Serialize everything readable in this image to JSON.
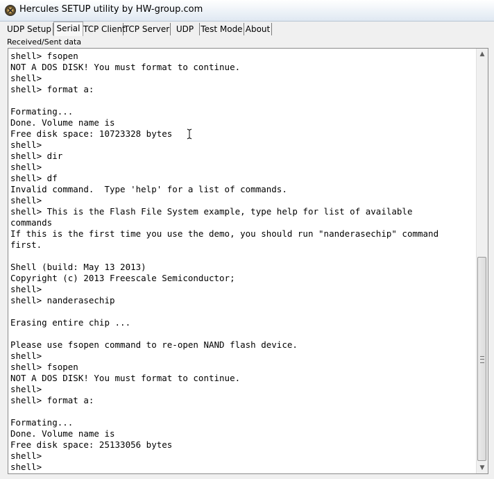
{
  "window": {
    "title": "Hercules SETUP utility by HW-group.com",
    "icon": "hercules-app-icon"
  },
  "tabs": [
    {
      "label": "UDP Setup",
      "active": false
    },
    {
      "label": "Serial",
      "active": true
    },
    {
      "label": "TCP Client",
      "active": false
    },
    {
      "label": "TCP Server",
      "active": false
    },
    {
      "label": "UDP",
      "active": false
    },
    {
      "label": "Test Mode",
      "active": false
    },
    {
      "label": "About",
      "active": false
    }
  ],
  "received_sent": {
    "label": "Received/Sent data",
    "lines": [
      "shell> fsopen",
      "NOT A DOS DISK! You must format to continue.",
      "shell>",
      "shell> format a:",
      "",
      "Formating...",
      "Done. Volume name is",
      "Free disk space: 10723328 bytes",
      "shell>",
      "shell> dir",
      "shell>",
      "shell> df",
      "Invalid command.  Type 'help' for a list of commands.",
      "shell>",
      "shell> This is the Flash File System example, type help for list of available",
      "commands",
      "If this is the first time you use the demo, you should run \"nanderasechip\" command",
      "first.",
      "",
      "Shell (build: May 13 2013)",
      "Copyright (c) 2013 Freescale Semiconductor;",
      "shell>",
      "shell> nanderasechip",
      "",
      "Erasing entire chip ...",
      "",
      "Please use fsopen command to re-open NAND flash device.",
      "shell>",
      "shell> fsopen",
      "NOT A DOS DISK! You must format to continue.",
      "shell>",
      "shell> format a:",
      "",
      "Formating...",
      "Done. Volume name is",
      "Free disk space: 25133056 bytes",
      "shell>",
      "shell>"
    ]
  },
  "scrollbar": {
    "up_icon": "scroll-up-arrow-icon",
    "down_icon": "scroll-down-arrow-icon"
  },
  "colors": {
    "titlebar": "#dfe8f2",
    "window_bg": "#f0f0f0",
    "terminal_bg": "#ffffff",
    "terminal_text": "#000000"
  }
}
